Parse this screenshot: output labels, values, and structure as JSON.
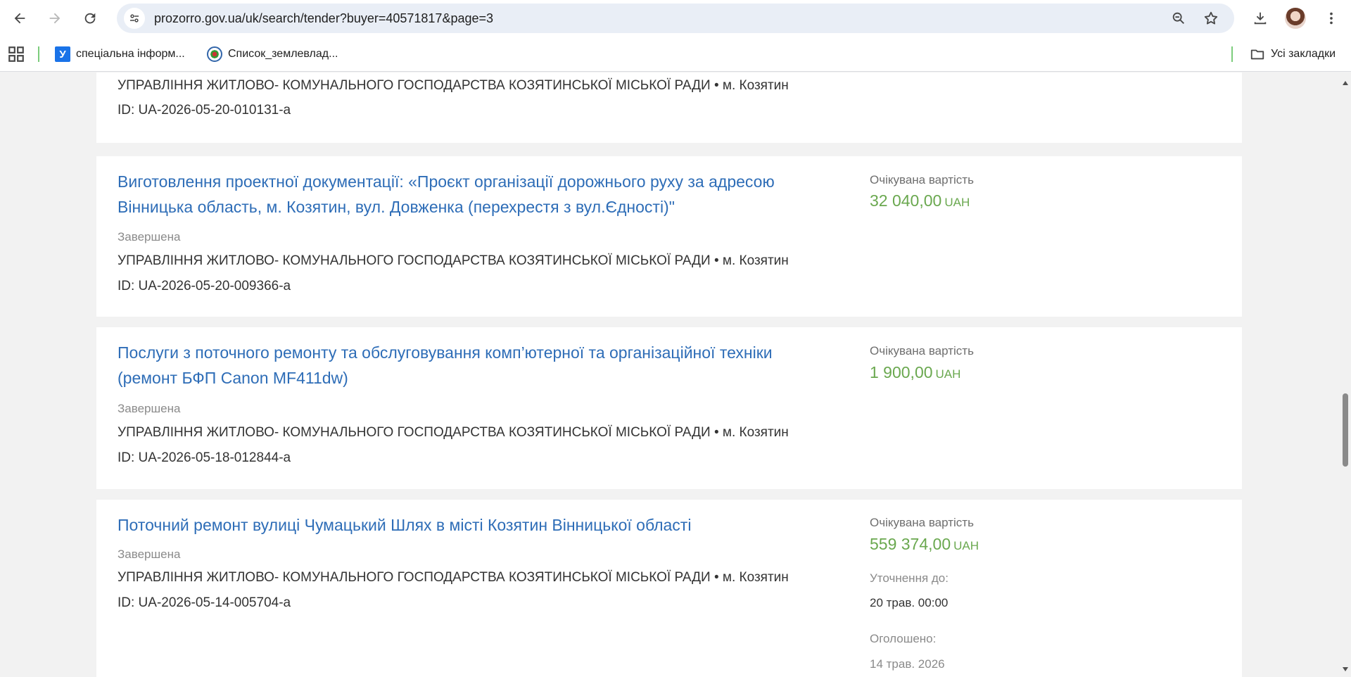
{
  "browser": {
    "url": "prozorro.gov.ua/uk/search/tender?buyer=40571817&page=3",
    "bookmarks": [
      {
        "label": "спеціальна інформ...",
        "icon": "u-favicon"
      },
      {
        "label": "Список_землевлад...",
        "icon": "wikimedia-favicon"
      }
    ],
    "all_bookmarks_label": "Усі закладки",
    "user_avatar": "profile-avatar"
  },
  "tenders": [
    {
      "buyer": "УПРАВЛІННЯ ЖИТЛОВО- КОМУНАЛЬНОГО ГОСПОДАРСТВА КОЗЯТИНСЬКОЇ МІСЬКОЇ РАДИ • м. Козятин",
      "id": "ID: UA-2026-05-20-010131-a"
    },
    {
      "title": "Виготовлення проектної документації: «Проєкт організації дорожнього руху за адресою Вінницька область, м. Козятин, вул. Довженка (перехрестя з вул.Єдності)\"",
      "status": "Завершена",
      "buyer": "УПРАВЛІННЯ ЖИТЛОВО- КОМУНАЛЬНОГО ГОСПОДАРСТВА КОЗЯТИНСЬКОЇ МІСЬКОЇ РАДИ • м. Козятин",
      "id": "ID: UA-2026-05-20-009366-a",
      "price_label": "Очікувана вартість",
      "price": "32 040,00",
      "currency": "UAH"
    },
    {
      "title": "Послуги з поточного ремонту та обслуговування комп’ютерної та організаційної техніки (ремонт БФП Canon MF411dw)",
      "status": "Завершена",
      "buyer": "УПРАВЛІННЯ ЖИТЛОВО- КОМУНАЛЬНОГО ГОСПОДАРСТВА КОЗЯТИНСЬКОЇ МІСЬКОЇ РАДИ • м. Козятин",
      "id": "ID: UA-2026-05-18-012844-a",
      "price_label": "Очікувана вартість",
      "price": "1 900,00",
      "currency": "UAH"
    },
    {
      "title": "Поточний ремонт вулиці Чумацький Шлях в місті Козятин Вінницької області",
      "status": "Завершена",
      "buyer": "УПРАВЛІННЯ ЖИТЛОВО- КОМУНАЛЬНОГО ГОСПОДАРСТВА КОЗЯТИНСЬКОЇ МІСЬКОЇ РАДИ • м. Козятин",
      "id": "ID: UA-2026-05-14-005704-a",
      "price_label": "Очікувана вартість",
      "price": "559 374,00",
      "currency": "UAH",
      "clarification_label": "Уточнення до:",
      "clarification_value": "20 трав. 00:00",
      "announced_label": "Оголошено:",
      "announced_value": "14 трав. 2026"
    }
  ]
}
